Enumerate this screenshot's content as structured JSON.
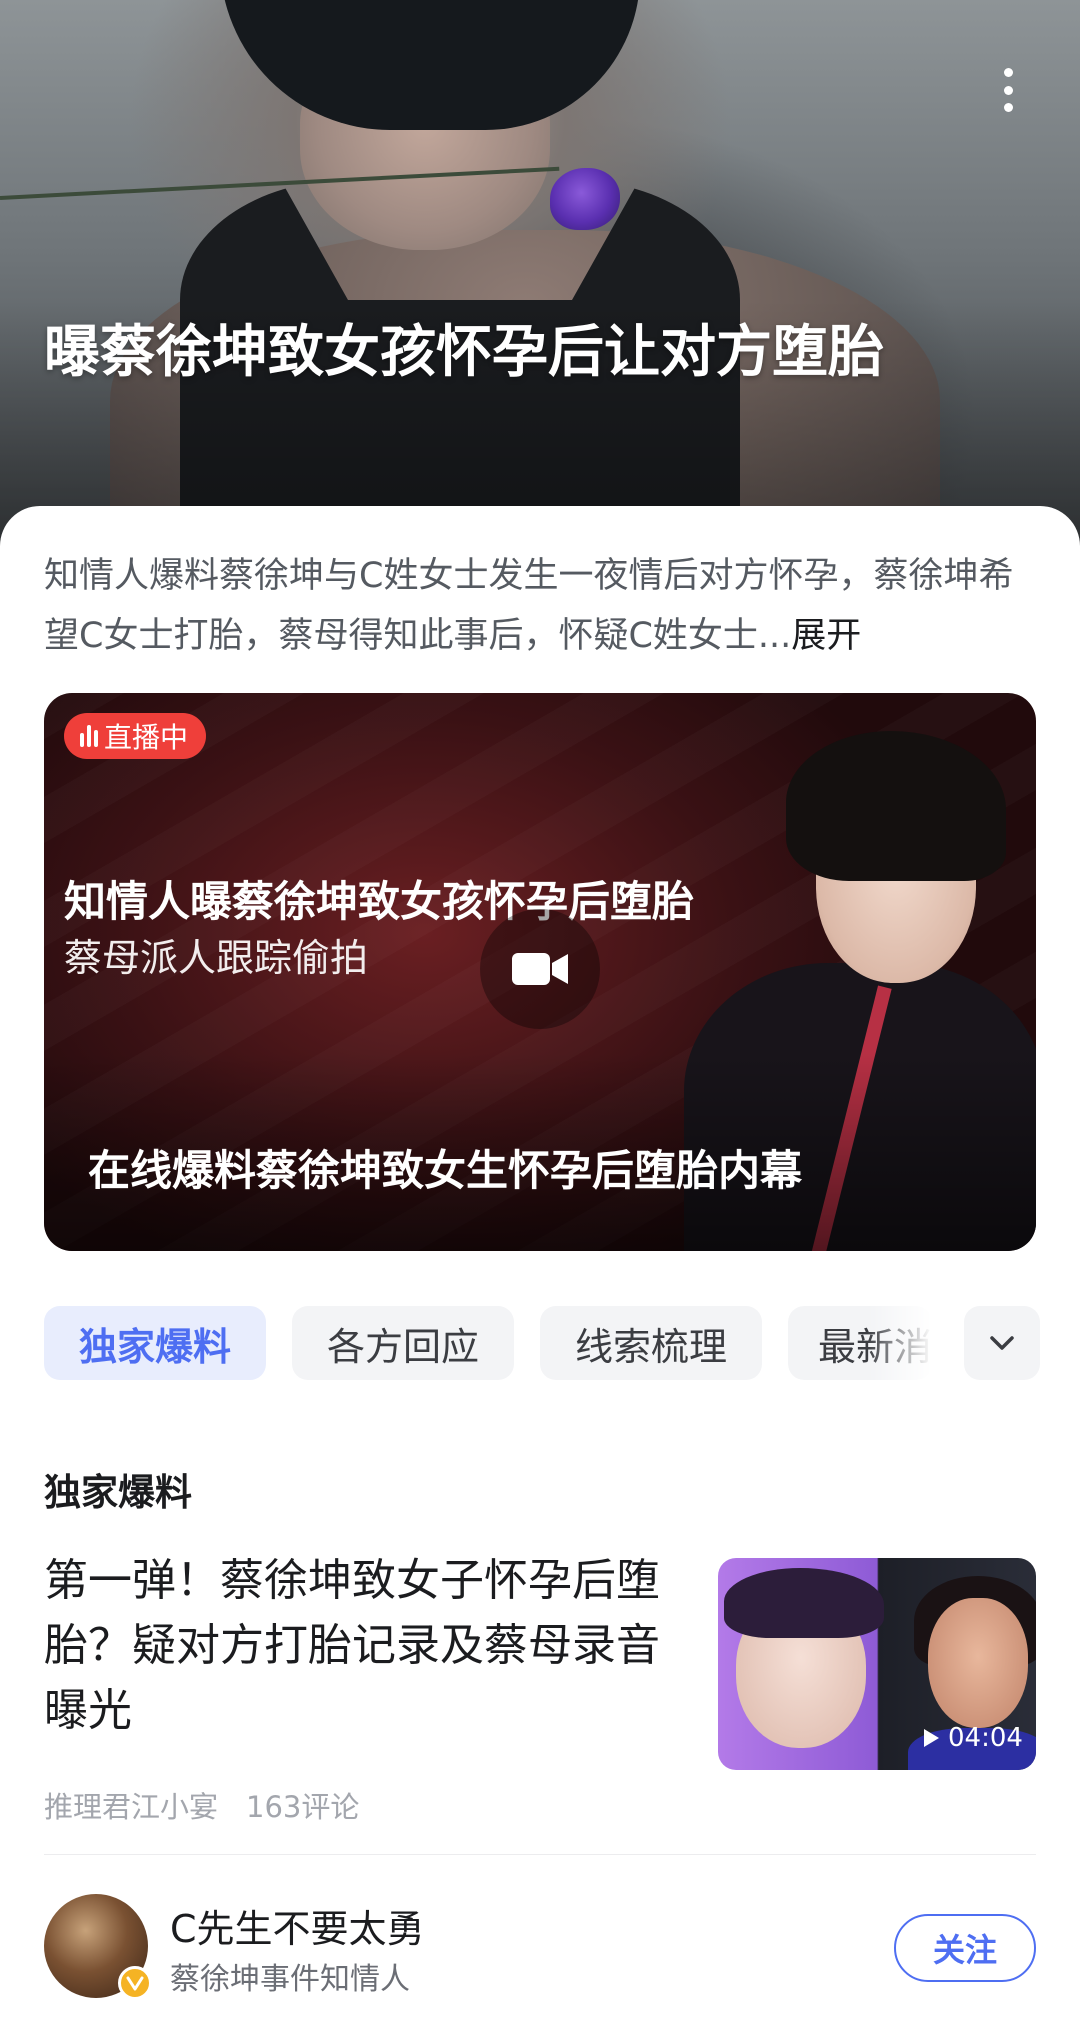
{
  "hero": {
    "title": "曝蔡徐坤致女孩怀孕后让对方堕胎"
  },
  "summary": {
    "text": "知情人爆料蔡徐坤与C姓女士发生一夜情后对方怀孕，蔡徐坤希望C女士打胎，蔡母得知此事后，怀疑C姓女士...",
    "expand_label": "展开"
  },
  "video_card": {
    "live_label": "直播中",
    "title": "知情人曝蔡徐坤致女孩怀孕后堕胎",
    "subtitle": "蔡母派人跟踪偷拍",
    "caption": "在线爆料蔡徐坤致女生怀孕后堕胎内幕",
    "live_color": "#ef3f3a"
  },
  "tabs": [
    {
      "label": "独家爆料",
      "active": true
    },
    {
      "label": "各方回应",
      "active": false
    },
    {
      "label": "线索梳理",
      "active": false
    },
    {
      "label": "最新消息",
      "active": false
    }
  ],
  "section": {
    "title": "独家爆料"
  },
  "article": {
    "title": "第一弹！蔡徐坤致女子怀孕后堕胎？疑对方打胎记录及蔡母录音曝光",
    "duration": "04:04",
    "source": "推理君江小宴",
    "comments": "163评论"
  },
  "author": {
    "name": "C先生不要太勇",
    "description": "蔡徐坤事件知情人",
    "follow_label": "关注"
  },
  "colors": {
    "accent": "#4e6ef2",
    "tab_active_bg": "#e8edfd",
    "verified_badge": "#f5b324"
  },
  "icons": {
    "more": "more-vertical-icon",
    "live": "live-bars-icon",
    "video": "video-camera-icon",
    "chevron": "chevron-down-icon",
    "play": "play-icon",
    "verified": "verified-v-icon"
  }
}
